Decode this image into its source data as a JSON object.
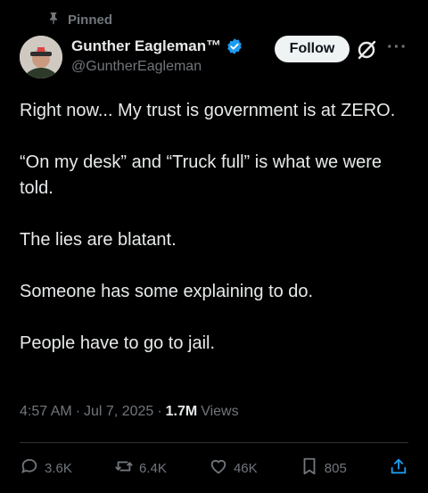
{
  "pinned": {
    "label": "Pinned",
    "icon": "pin-icon"
  },
  "author": {
    "name": "Gunther Eagleman™",
    "handle": "@GuntherEagleman",
    "verified": true
  },
  "follow_button": {
    "label": "Follow"
  },
  "tweet": {
    "paragraphs": [
      "Right now... My trust is government is at ZERO.",
      "“On my desk” and “Truck full” is what we were told.",
      "The lies are blatant.",
      "Someone has some explaining to do.",
      "People have to go to jail."
    ]
  },
  "meta": {
    "time": "4:57 AM",
    "date": "Jul 7, 2025",
    "views_count": "1.7M",
    "views_label": "Views"
  },
  "actions": {
    "replies": "3.6K",
    "reposts": "6.4K",
    "likes": "46K",
    "bookmarks": "805"
  },
  "colors": {
    "background": "#000000",
    "text": "#e7e9ea",
    "secondary": "#71767b",
    "verified": "#1d9bf0"
  }
}
